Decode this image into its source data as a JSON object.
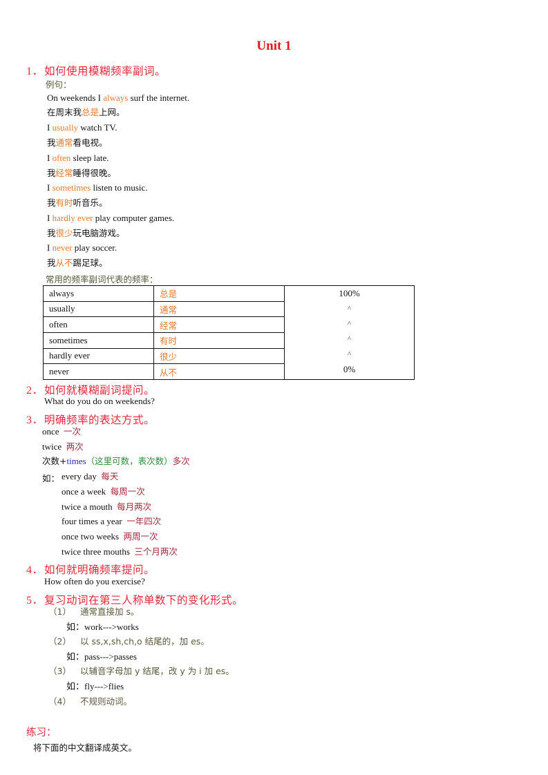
{
  "title": "Unit 1",
  "section1": {
    "number": "1．",
    "heading": "如何使用模糊频率副词。",
    "examples_label": "例句：",
    "examples": [
      {
        "before": "On weekends I ",
        "highlight": "always",
        "after": " surf the internet."
      },
      {
        "before": "在周末我",
        "highlight": "总是",
        "after": "上网。"
      },
      {
        "before": "I ",
        "highlight": "usually",
        "after": " watch TV."
      },
      {
        "before": "我",
        "highlight": "通常",
        "after": "看电视。"
      },
      {
        "before": "I ",
        "highlight": "often",
        "after": " sleep late."
      },
      {
        "before": "我",
        "highlight": "经常",
        "after": "睡得很晚。"
      },
      {
        "before": "I ",
        "highlight": "sometimes",
        "after": " listen to music."
      },
      {
        "before": "我",
        "highlight": "有时",
        "after": "听音乐。"
      },
      {
        "before": "I ",
        "highlight": "hardly ever",
        "after": " play computer games."
      },
      {
        "before": "我",
        "highlight": "很少",
        "after": "玩电脑游戏。"
      },
      {
        "before": "I ",
        "highlight": "never",
        "after": " play soccer."
      },
      {
        "before": "我",
        "highlight": "从不",
        "after": "踢足球。"
      }
    ],
    "table_caption": "常用的频率副词代表的频率：",
    "table": {
      "rows": [
        {
          "en": "always",
          "cn": "总是"
        },
        {
          "en": "usually",
          "cn": "通常"
        },
        {
          "en": "often",
          "cn": "经常"
        },
        {
          "en": "sometimes",
          "cn": "有时"
        },
        {
          "en": "hardly ever",
          "cn": "很少"
        },
        {
          "en": "never",
          "cn": "从不"
        }
      ],
      "scale": [
        "100%",
        "^",
        "^",
        "^",
        "^",
        "0%"
      ]
    }
  },
  "section2": {
    "number": "2．",
    "heading": "如何就模糊副词提问。",
    "text": "What do you do on weekends?"
  },
  "section3": {
    "number": "3．",
    "heading": "明确频率的表达方式。",
    "once": {
      "en": "once",
      "cn": "一次"
    },
    "twice": {
      "en": "twice",
      "cn": "两次"
    },
    "times_rule": {
      "prefix": "次数+",
      "times": "times",
      "note": "（这里可数，表次数）",
      "meaning": "多次"
    },
    "eg_label": "如：",
    "examples": [
      {
        "en": "every day",
        "cn": "每天"
      },
      {
        "en": "once a week",
        "cn": "每周一次"
      },
      {
        "en": "twice a mouth",
        "cn": "每月两次"
      },
      {
        "en": "four times a year",
        "cn": "一年四次"
      },
      {
        "en": "once two weeks",
        "cn": "两周一次"
      },
      {
        "en": "twice three mouths",
        "cn": "三个月两次"
      }
    ]
  },
  "section4": {
    "number": "4．",
    "heading": "如何就明确频率提问。",
    "text": "How often do you exercise?"
  },
  "section5": {
    "number": "5．",
    "heading": "复习动词在第三人称单数下的变化形式。",
    "rules": [
      {
        "label": "（1）",
        "text": "通常直接加 s。",
        "example": "如：work--->works"
      },
      {
        "label": "（2）",
        "text": "以 ss,x,sh,ch,o 结尾的，加 es。",
        "example": "如：pass--->passes"
      },
      {
        "label": "（3）",
        "text": "以辅音字母加 y 结尾，改 y 为 i 加 es。",
        "example": "如：fly--->flies"
      },
      {
        "label": "（4）",
        "text": "不规则动词。",
        "example": null
      }
    ]
  },
  "practice": {
    "label": "练习：",
    "instruction": "将下面的中文翻译成英文。"
  }
}
